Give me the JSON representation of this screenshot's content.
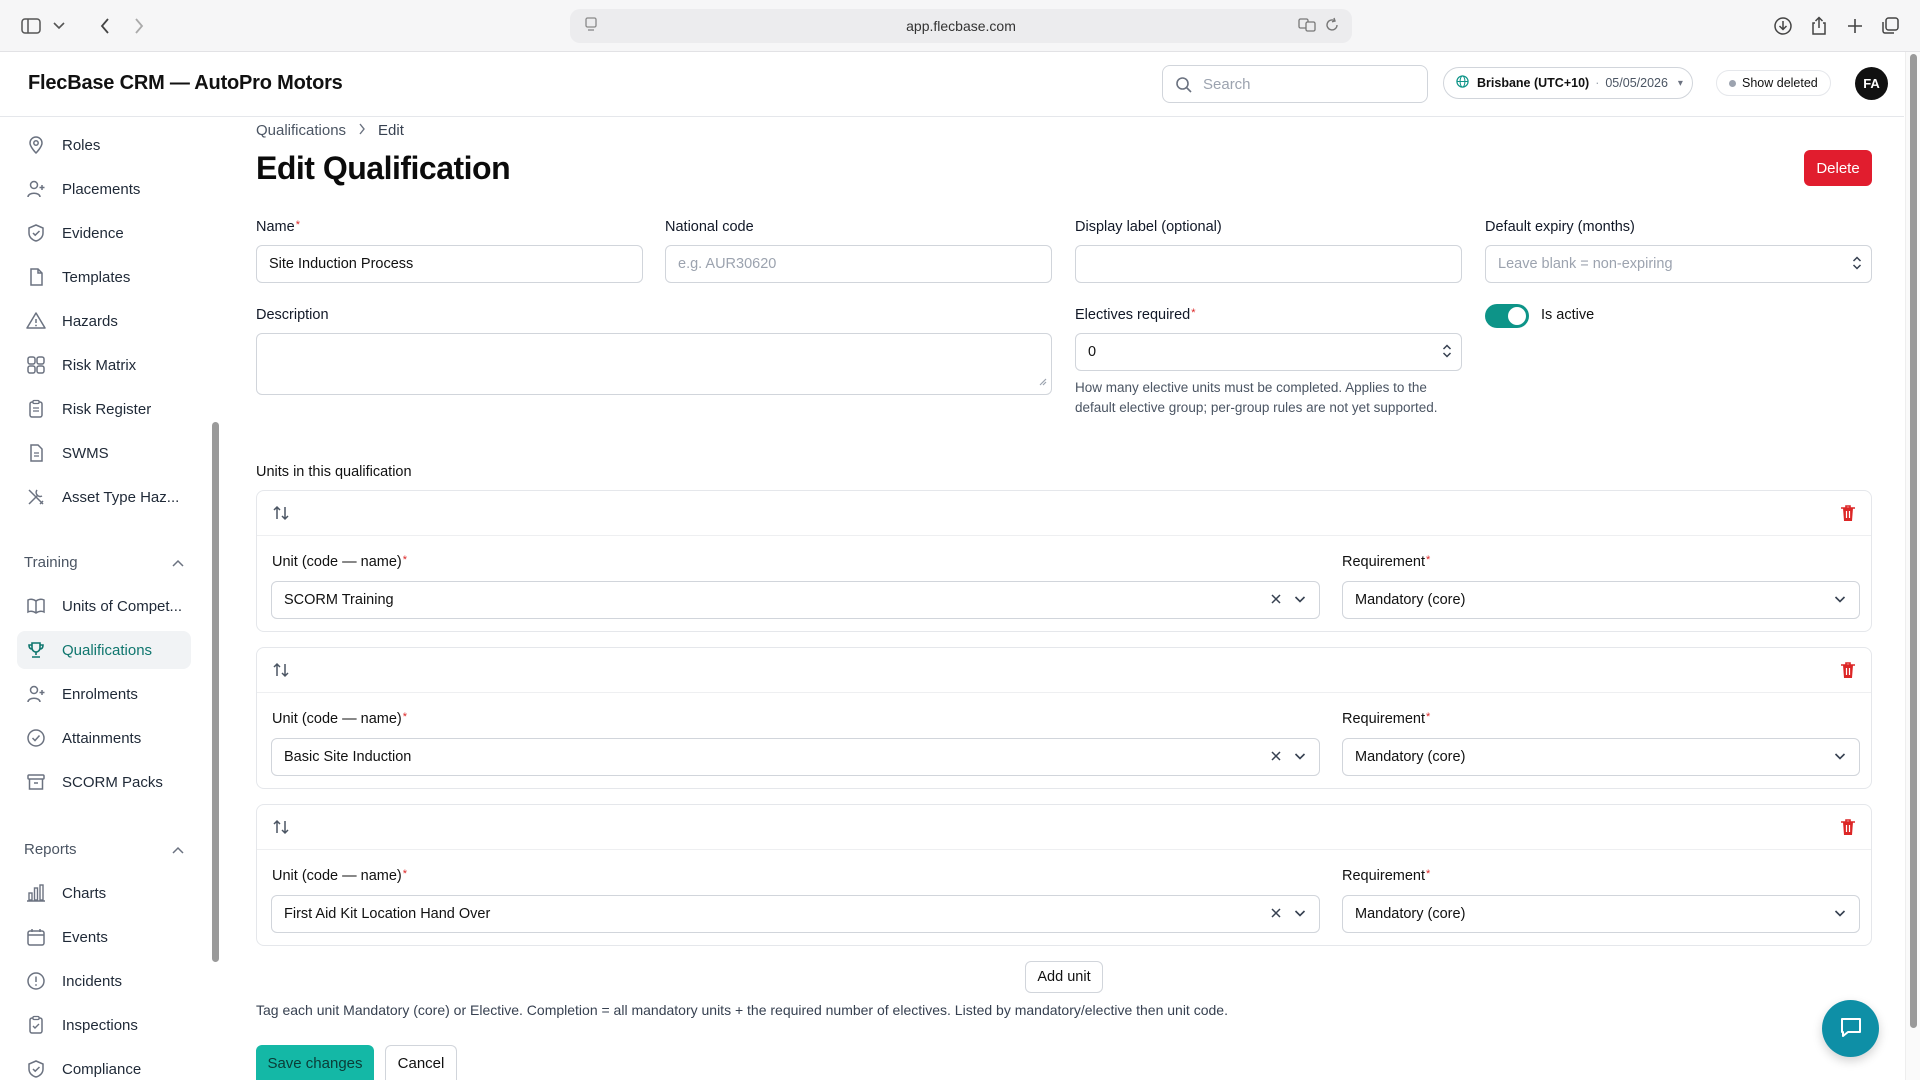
{
  "browser": {
    "url": "app.flecbase.com"
  },
  "header": {
    "app_title": "FlecBase CRM — AutoPro Motors",
    "search_placeholder": "Search",
    "timezone_city": "Brisbane (UTC+10)",
    "timezone_date": "05/05/2026",
    "show_deleted_label": "Show deleted",
    "avatar_initials": "FA"
  },
  "sidebar": {
    "items_top": [
      {
        "label": "Roles",
        "icon": "map-pin-icon"
      },
      {
        "label": "Placements",
        "icon": "user-plus-icon"
      },
      {
        "label": "Evidence",
        "icon": "shield-check-icon"
      },
      {
        "label": "Templates",
        "icon": "document-icon"
      },
      {
        "label": "Hazards",
        "icon": "warning-icon"
      },
      {
        "label": "Risk Matrix",
        "icon": "grid-icon"
      },
      {
        "label": "Risk Register",
        "icon": "clipboard-icon"
      },
      {
        "label": "SWMS",
        "icon": "file-text-icon"
      },
      {
        "label": "Asset Type Haz...",
        "icon": "tools-icon"
      }
    ],
    "group_training": "Training",
    "items_training": [
      {
        "label": "Units of Compet...",
        "icon": "book-icon"
      },
      {
        "label": "Qualifications",
        "icon": "trophy-icon"
      },
      {
        "label": "Enrolments",
        "icon": "user-plus-icon"
      },
      {
        "label": "Attainments",
        "icon": "check-circle-icon"
      },
      {
        "label": "SCORM Packs",
        "icon": "archive-icon"
      }
    ],
    "group_reports": "Reports",
    "items_reports": [
      {
        "label": "Charts",
        "icon": "bar-chart-icon"
      },
      {
        "label": "Events",
        "icon": "calendar-icon"
      },
      {
        "label": "Incidents",
        "icon": "alert-circle-icon"
      },
      {
        "label": "Inspections",
        "icon": "clipboard-check-icon"
      },
      {
        "label": "Compliance",
        "icon": "shield-check-icon"
      }
    ]
  },
  "breadcrumb": {
    "parent": "Qualifications",
    "current": "Edit"
  },
  "page": {
    "title": "Edit Qualification",
    "delete_label": "Delete"
  },
  "form": {
    "name_label": "Name",
    "name_value": "Site Induction Process",
    "national_code_label": "National code",
    "national_code_placeholder": "e.g. AUR30620",
    "display_label_label": "Display label (optional)",
    "display_label_value": "",
    "default_expiry_label": "Default expiry (months)",
    "default_expiry_placeholder": "Leave blank = non-expiring",
    "description_label": "Description",
    "electives_label": "Electives required",
    "electives_value": "0",
    "electives_help": "How many elective units must be completed. Applies to the default elective group; per-group rules are not yet supported.",
    "is_active_label": "Is active",
    "is_active": true
  },
  "units": {
    "section_label": "Units in this qualification",
    "unit_label": "Unit (code — name)",
    "requirement_label": "Requirement",
    "rows": [
      {
        "unit": "SCORM Training",
        "requirement": "Mandatory (core)"
      },
      {
        "unit": "Basic Site Induction",
        "requirement": "Mandatory (core)"
      },
      {
        "unit": "First Aid Kit Location Hand Over",
        "requirement": "Mandatory (core)"
      }
    ],
    "add_label": "Add unit",
    "footnote": "Tag each unit Mandatory (core) or Elective. Completion = all mandatory units + the required number of electives. Listed by mandatory/elective then unit code."
  },
  "actions": {
    "save_label": "Save changes",
    "cancel_label": "Cancel"
  },
  "colors": {
    "accent": "#0d9488",
    "danger": "#e11d2e",
    "save": "#14b8a6",
    "chat": "#0e8fa6"
  }
}
